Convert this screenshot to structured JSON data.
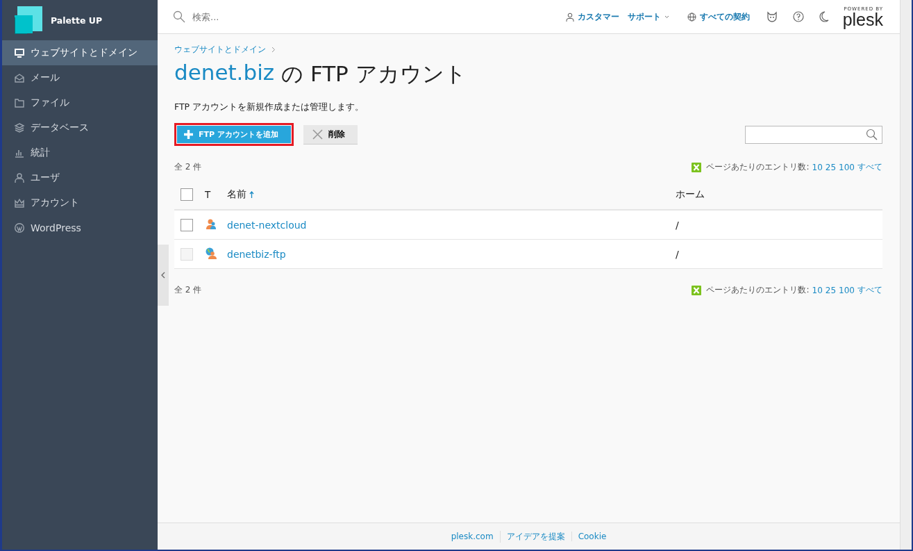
{
  "brand": {
    "name": "Palette UP"
  },
  "sidebar": {
    "items": [
      {
        "label": "ウェブサイトとドメイン",
        "kind": "monitor",
        "selected": true
      },
      {
        "label": "メール",
        "kind": "mail",
        "selected": false
      },
      {
        "label": "ファイル",
        "kind": "folder",
        "selected": false
      },
      {
        "label": "データベース",
        "kind": "layers",
        "selected": false
      },
      {
        "label": "統計",
        "kind": "chart",
        "selected": false
      },
      {
        "label": "ユーザ",
        "kind": "user",
        "selected": false
      },
      {
        "label": "アカウント",
        "kind": "crown",
        "selected": false
      },
      {
        "label": "WordPress",
        "kind": "wp",
        "selected": false
      }
    ]
  },
  "topbar": {
    "search": {
      "placeholder": "検索..."
    },
    "customer": "カスタマー",
    "support": "サポート",
    "subscriptions": "すべての契約",
    "powered_by": "POWERED BY",
    "logo": "plesk"
  },
  "breadcrumb": [
    "ウェブサイトとドメイン"
  ],
  "title": {
    "domain": "denet.biz",
    "rest": "の FTP アカウント"
  },
  "description": "FTP アカウントを新規作成または管理します。",
  "toolbar": {
    "add_button": "FTP アカウントを追加",
    "delete_button": "削除"
  },
  "pager_top": {
    "total": "全 2 件",
    "label": "ページあたりのエントリ数:",
    "sizes": [
      "10",
      "25",
      "100",
      "すべて"
    ]
  },
  "table": {
    "select_all_checked": false,
    "columns": [
      {
        "label": "T"
      },
      {
        "label": "名前",
        "sorted": true
      },
      {
        "label": "ホーム"
      }
    ],
    "rows": [
      {
        "kind": "user",
        "name": "denet-nextcloud",
        "home": "/",
        "checked": false,
        "disabled": false
      },
      {
        "kind": "web-user",
        "name": "denetbiz-ftp",
        "home": "/",
        "checked": false,
        "disabled": true
      }
    ]
  },
  "pager_bottom": {
    "total": "全 2 件",
    "label": "ページあたりのエントリ数:",
    "sizes": [
      "10",
      "25",
      "100",
      "すべて"
    ]
  },
  "footer": {
    "links": [
      "plesk.com",
      "アイデアを提案",
      "Cookie"
    ]
  }
}
